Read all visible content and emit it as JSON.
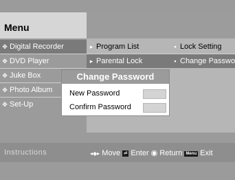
{
  "menu": {
    "title": "Menu"
  },
  "col1": [
    {
      "label": "Digital Recorder",
      "marker": "✥",
      "selected": true
    },
    {
      "label": "DVD Player",
      "marker": "✥"
    },
    {
      "label": "Juke Box",
      "marker": "✥"
    },
    {
      "label": "Photo Album",
      "marker": "✥"
    },
    {
      "label": "Set-Up",
      "marker": "✥"
    }
  ],
  "col2": [
    {
      "label": "Program List",
      "marker": "▸"
    },
    {
      "label": "Parental Lock",
      "marker": "▸",
      "selected": true
    }
  ],
  "col3": [
    {
      "label": "Lock Setting",
      "marker": "▪"
    },
    {
      "label": "Change Password",
      "marker": "▪",
      "selected": true
    }
  ],
  "dialog": {
    "title": "Change Password",
    "new_password_label": "New Password",
    "confirm_password_label": "Confirm Password"
  },
  "instructions": {
    "heading": "Instructions",
    "move_icon": "◂◆▸",
    "move_label": "Move",
    "enter_label": "Enter",
    "return_label": "Return",
    "menu_key": "Menu",
    "exit_label": "Exit"
  }
}
